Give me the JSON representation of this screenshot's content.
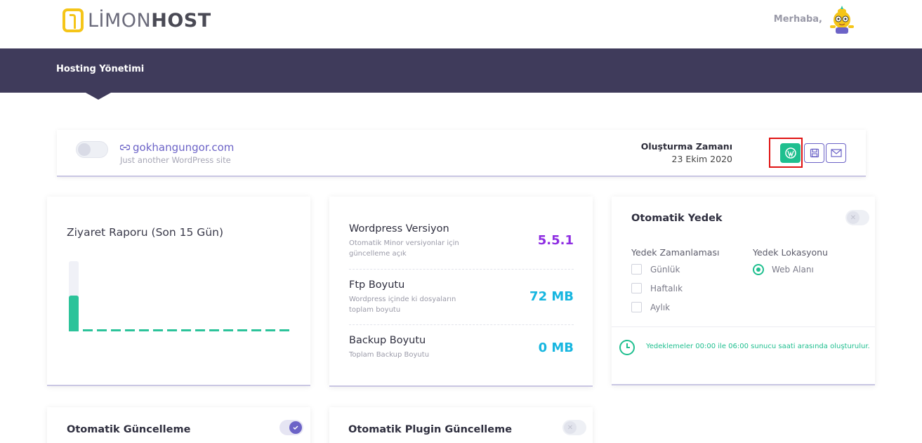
{
  "header": {
    "logo_light": "LİMON",
    "logo_bold": "HOST",
    "greeting": "Merhaba,"
  },
  "nav": {
    "title": "Hosting Yönetimi"
  },
  "site": {
    "domain": "gokhangungor.com",
    "subtitle": "Just another WordPress site",
    "created_label": "Oluşturma Zamanı",
    "created_date": "23 Ekim 2020",
    "active": false
  },
  "visit_report": {
    "title": "Ziyaret Raporu (Son 15 Gün)"
  },
  "stats": [
    {
      "label": "Wordpress Versiyon",
      "desc": "Otomatik Minor versiyonlar için güncelleme açık",
      "value": "5.5.1",
      "color": "#8e2de2"
    },
    {
      "label": "Ftp Boyutu",
      "desc": "Wordpress içinde ki dosyaların toplam boyutu",
      "value": "72 MB",
      "color": "#17b6e0"
    },
    {
      "label": "Backup Boyutu",
      "desc": "Toplam Backup Boyutu",
      "value": "0 MB",
      "color": "#17b6e0"
    }
  ],
  "backup": {
    "title": "Otomatik Yedek",
    "enabled": false,
    "schedule_label": "Yedek Zamanlaması",
    "location_label": "Yedek Lokasyonu",
    "schedule_options": [
      "Günlük",
      "Haftalık",
      "Aylık"
    ],
    "location_option": "Web Alanı",
    "note": "Yedeklemeler 00:00 ile 06:00 sunucu saati arasında oluşturulur."
  },
  "auto_update": {
    "title": "Otomatik Güncelleme",
    "enabled": true
  },
  "auto_plugin_update": {
    "title": "Otomatik Plugin Güncelleme",
    "enabled": false
  },
  "colors": {
    "accent": "#6c63c7",
    "green": "#1fbf8f",
    "nav": "#3f3b5b",
    "logo": "#f5c518"
  }
}
